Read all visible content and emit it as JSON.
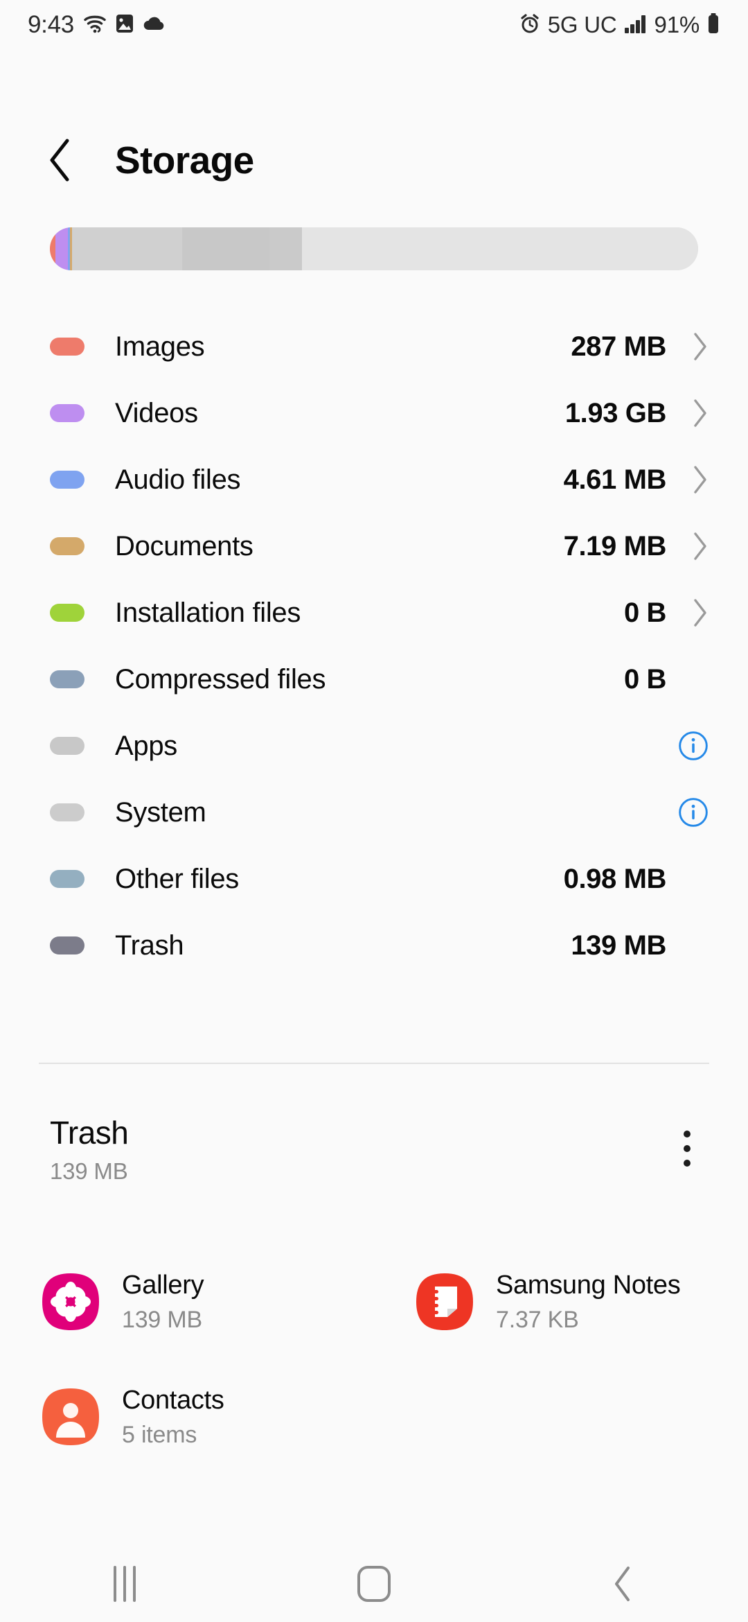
{
  "statusbar": {
    "time": "9:43",
    "network_label": "5G UC",
    "battery_percent": "91%",
    "icons_left": [
      "wifi-question-icon",
      "image-icon",
      "cloud-icon"
    ],
    "icons_right": [
      "alarm-icon",
      "signal-bars-icon",
      "battery-icon"
    ]
  },
  "header": {
    "title": "Storage",
    "back_icon": "chevron-left-icon"
  },
  "storage_bar": {
    "segments": [
      {
        "name": "Images",
        "color": "#EE7B6B",
        "percent": 0.9
      },
      {
        "name": "Videos",
        "color": "#BE8EF0",
        "percent": 1.9
      },
      {
        "name": "Audio files",
        "color": "#7FA3F0",
        "percent": 0.3
      },
      {
        "name": "Documents",
        "color": "#D4A96A",
        "percent": 0.3
      },
      {
        "name": "Apps",
        "color": "#D0D0D0",
        "percent": 17.0
      },
      {
        "name": "System",
        "color": "#C8C8C8",
        "percent": 13.5
      },
      {
        "name": "Other files",
        "color": "#CACACA",
        "percent": 5.0
      },
      {
        "name": "Free",
        "color": "#E4E4E4",
        "percent": 61.1
      }
    ],
    "track_color": "#E4E4E4"
  },
  "categories": [
    {
      "label": "Images",
      "value": "287 MB",
      "color": "#EE7B6B",
      "trailing": "chevron"
    },
    {
      "label": "Videos",
      "value": "1.93 GB",
      "color": "#BE8EF0",
      "trailing": "chevron"
    },
    {
      "label": "Audio files",
      "value": "4.61 MB",
      "color": "#7FA3F0",
      "trailing": "chevron"
    },
    {
      "label": "Documents",
      "value": "7.19 MB",
      "color": "#D4A96A",
      "trailing": "chevron"
    },
    {
      "label": "Installation files",
      "value": "0 B",
      "color": "#9FD33A",
      "trailing": "chevron"
    },
    {
      "label": "Compressed files",
      "value": "0 B",
      "color": "#8BA0B8",
      "trailing": "none"
    },
    {
      "label": "Apps",
      "value": "",
      "color": "#C8C8C8",
      "trailing": "info"
    },
    {
      "label": "System",
      "value": "",
      "color": "#CCCCCC",
      "trailing": "info"
    },
    {
      "label": "Other files",
      "value": "0.98 MB",
      "color": "#94AFC0",
      "trailing": "none"
    },
    {
      "label": "Trash",
      "value": "139 MB",
      "color": "#7C7C8A",
      "trailing": "none"
    }
  ],
  "trash_section": {
    "title": "Trash",
    "size": "139 MB",
    "menu_icon": "more-vertical-icon",
    "apps": [
      {
        "name": "Gallery",
        "size": "139 MB",
        "icon": "gallery-icon",
        "color": "#E0007A"
      },
      {
        "name": "Samsung Notes",
        "size": "7.37 KB",
        "icon": "samsung-notes-icon",
        "color": "#EE3524"
      },
      {
        "name": "Contacts",
        "size": "5 items",
        "icon": "contacts-icon",
        "color": "#F5603E"
      }
    ]
  },
  "navbar": {
    "recents_icon": "recents-icon",
    "home_icon": "home-icon",
    "back_icon": "back-chevron-icon"
  },
  "colors": {
    "accent_blue": "#2589E8",
    "text_primary": "#0A0A0A",
    "text_secondary": "#8A8A8A",
    "background": "#FAFAFA"
  }
}
